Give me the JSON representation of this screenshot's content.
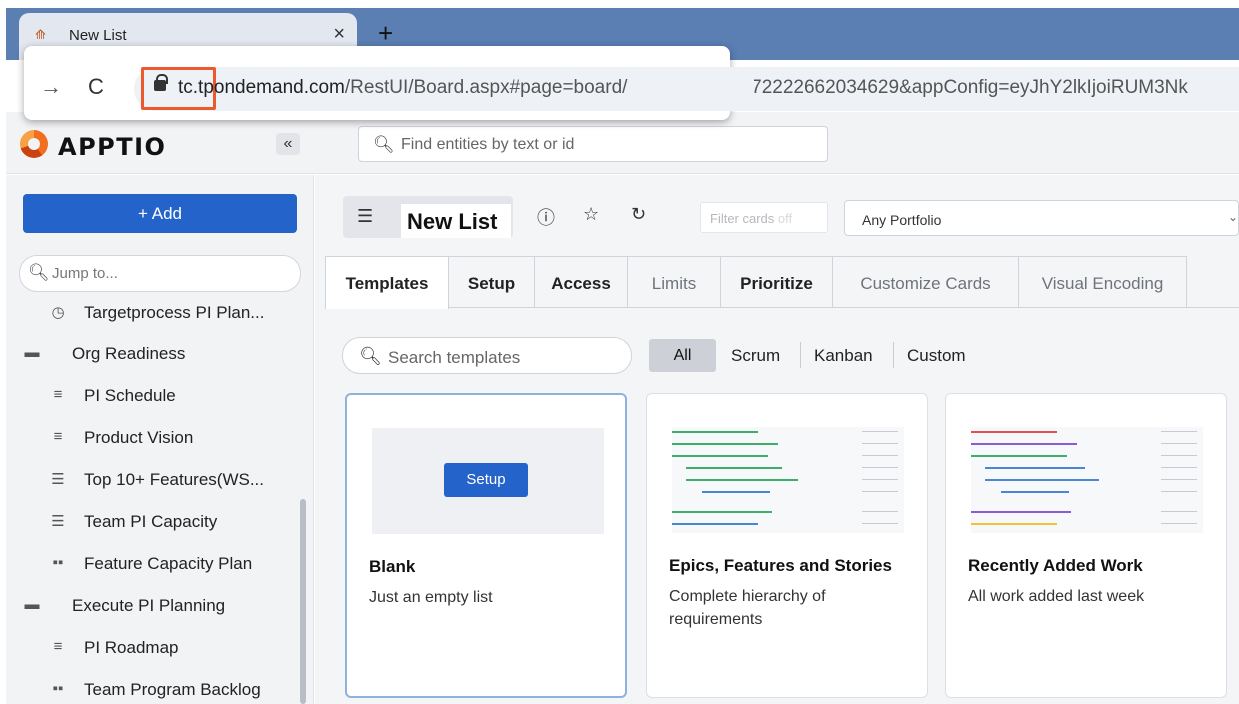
{
  "browser": {
    "tab_title": "New List",
    "tab_close": "×",
    "new_tab": "+",
    "url_host": "tc.tpondemand.com",
    "url_path": "/RestUI/Board.aspx#page=board/",
    "url_rest": "3372222662034629&appConfig=eyJhY2lkIjoiRUM3Nk"
  },
  "header": {
    "logo": "APPTIO",
    "collapse": "«",
    "search_placeholder": "Find entities by text or id"
  },
  "sidebar": {
    "add_label": "+ Add",
    "jump_placeholder": "Jump to...",
    "items": [
      {
        "label": "Targetprocess PI Plan...",
        "icon": "clock-icon"
      },
      {
        "label": "Org Readiness",
        "icon": "folder-icon"
      },
      {
        "label": "PI Schedule",
        "icon": "timeline-icon"
      },
      {
        "label": "Product Vision",
        "icon": "timeline-icon"
      },
      {
        "label": "Top 10+ Features(WS...",
        "icon": "list-icon"
      },
      {
        "label": "Team PI Capacity",
        "icon": "list-icon"
      },
      {
        "label": "Feature Capacity Plan",
        "icon": "board-icon"
      },
      {
        "label": "Execute PI Planning",
        "icon": "folder-icon"
      },
      {
        "label": "PI Roadmap",
        "icon": "timeline-icon"
      },
      {
        "label": "Team Program Backlog",
        "icon": "board-icon"
      }
    ]
  },
  "toolbar": {
    "list_title": "New List",
    "filter_cards": "Filter cards",
    "filter_cards_off": "off",
    "portfolio": "Any Portfolio"
  },
  "tabs": [
    "Templates",
    "Setup",
    "Access",
    "Limits",
    "Prioritize",
    "Customize Cards",
    "Visual Encoding"
  ],
  "templates": {
    "search_placeholder": "Search templates",
    "filters": [
      "All",
      "Scrum",
      "Kanban",
      "Custom"
    ],
    "cards": [
      {
        "title": "Blank",
        "desc": "Just an empty list",
        "button": "Setup"
      },
      {
        "title": "Epics, Features and Stories",
        "desc": "Complete hierarchy of requirements"
      },
      {
        "title": "Recently Added Work",
        "desc": "All work added last week"
      }
    ]
  },
  "colors": {
    "accent": "#2463c9",
    "highlight": "#ea5a2d"
  }
}
